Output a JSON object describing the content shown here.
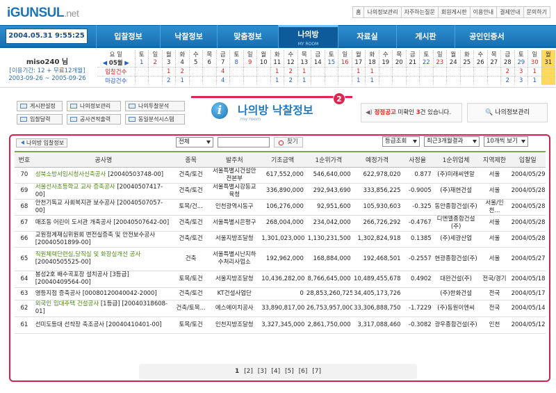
{
  "logo": {
    "main": "iGUNSUL",
    "ext": ".net"
  },
  "topnav": [
    "홈",
    "나의정보관리",
    "자주하는질문",
    "회원게시판",
    "이용안내",
    "결제안내",
    "문의하기"
  ],
  "datetime": "2004.05.31 9:55:25",
  "nav": [
    {
      "label": "입찰정보"
    },
    {
      "label": "낙찰정보"
    },
    {
      "label": "맞춤정보"
    },
    {
      "label": "나의방",
      "sub": "MY ROOM"
    },
    {
      "label": "자료실"
    },
    {
      "label": "게시판"
    },
    {
      "label": "공인인증서"
    }
  ],
  "user": {
    "name": "miso240 님",
    "period": "[이용기간: 12 + 무료12개월]",
    "range": "2003-09-26 ~ 2005-09-26"
  },
  "calendar": {
    "weekday_label": "요 일",
    "month_label": "05월",
    "bid_label": "입찰건수",
    "award_label": "마감건수",
    "weekdays": [
      "토",
      "일",
      "월",
      "화",
      "수",
      "목",
      "금",
      "토",
      "일",
      "월",
      "화",
      "수",
      "목",
      "금",
      "토",
      "일",
      "월",
      "화",
      "수",
      "목",
      "금",
      "토",
      "일",
      "월",
      "화",
      "수",
      "목",
      "금",
      "토",
      "일",
      "월"
    ],
    "days": [
      "1",
      "2",
      "3",
      "4",
      "5",
      "6",
      "7",
      "8",
      "9",
      "10",
      "11",
      "12",
      "13",
      "14",
      "15",
      "16",
      "17",
      "18",
      "19",
      "20",
      "21",
      "22",
      "23",
      "24",
      "25",
      "26",
      "27",
      "28",
      "29",
      "30",
      "31"
    ],
    "bids": [
      "",
      "",
      "1",
      "2",
      "",
      "",
      "4",
      "",
      "",
      "",
      "1",
      "2",
      "1",
      "",
      "",
      "",
      "1",
      "1",
      "",
      "",
      "",
      "",
      "",
      "",
      "",
      "",
      "",
      "2",
      "3",
      "1",
      ""
    ],
    "closes": [
      "",
      "",
      "2",
      "1",
      "",
      "",
      "4",
      "",
      "",
      "",
      "1",
      "2",
      "1",
      "",
      "",
      "",
      "1",
      "1",
      "",
      "",
      "",
      "",
      "",
      "",
      "",
      "",
      "",
      "2",
      "3",
      "1",
      ""
    ]
  },
  "buttons": [
    "게시판설정",
    "나의정보관리",
    "나의투찰분석",
    "입찰달력",
    "공사견적출력",
    "동일분석시스템"
  ],
  "title": {
    "main": "나의방 낙찰정보",
    "sub": "my room",
    "badge": "2"
  },
  "notice": {
    "pre": "정정공고",
    "mid": "미확인",
    "count": "3",
    "post": "건 있습니다."
  },
  "myinfo_label": "나의정보관리",
  "back_label": "나의방 입찰정보",
  "search": {
    "scope": "전체",
    "button": "찾기"
  },
  "filters": [
    "등급조회",
    "최근3개월결과",
    "10개씩 보기"
  ],
  "columns": [
    "번호",
    "공사명",
    "종목",
    "발주처",
    "기초금액",
    "1순위가격",
    "예정가격",
    "사정율",
    "1순위업체",
    "지역제한",
    "입찰일"
  ],
  "rows": [
    {
      "no": "70",
      "name": "성북소방서임시청사신축공사",
      "code": "[20040503748-00]",
      "tag": "",
      "green": true,
      "type": "건축/토건",
      "client": "서울특별시건설안전본부",
      "base": "617,552,000",
      "first": "546,640,000",
      "est": "622,978,020",
      "rate": "0.877",
      "firm": "(주)미래씨엔알",
      "region": "서울",
      "date": "2004/05/29"
    },
    {
      "no": "69",
      "name": "서울선사초등학교 교사 증축공사",
      "code": "[20040507417-00]",
      "tag": "",
      "green": true,
      "type": "건축/토건",
      "client": "서울특별시강동교육청",
      "base": "336,890,000",
      "first": "292,943,690",
      "est": "333,856,225",
      "rate": "-0.9005",
      "firm": "(주)재현건설",
      "region": "서울",
      "date": "2004/05/28"
    },
    {
      "no": "68",
      "name": "안천기독교 사회복지관 보수공사",
      "code": "[20040507057-00]",
      "tag": "",
      "green": false,
      "type": "토목/건...",
      "client": "인천광역시동구",
      "base": "106,276,000",
      "first": "92,951,600",
      "est": "105,930,603",
      "rate": "-0.325",
      "firm": "동안종합건설(주)",
      "region": "서울/인천...",
      "date": "2004/05/28"
    },
    {
      "no": "67",
      "name": "매조동 어린이 도서관 개축공사",
      "code": "[20040507642-00]",
      "tag": "",
      "green": false,
      "type": "건축/토건",
      "client": "서울특별시은평구",
      "base": "268,004,000",
      "first": "234,042,000",
      "est": "266,726,292",
      "rate": "-0.4767",
      "firm": "디엔엘종합건설(주)",
      "region": "서울",
      "date": "2004/05/28"
    },
    {
      "no": "66",
      "name": "교원정계재심위원회 변전실증축 및 안전보수공사",
      "code": "[20040501899-00]",
      "tag": "",
      "green": false,
      "type": "건축/토건",
      "client": "서울지방조달청",
      "base": "1,301,023,000",
      "first": "1,130,231,500",
      "est": "1,302,824,918",
      "rate": "0.1385",
      "firm": "(주)세광산업",
      "region": "서울",
      "date": "2004/05/28"
    },
    {
      "no": "65",
      "name": "직원체력단련실,당직실 및 화장실개선 공사",
      "code": "[20040505525-00]",
      "tag": "",
      "green": true,
      "type": "건축",
      "client": "서울특별시난지하수처리사업소",
      "base": "192,962,000",
      "first": "168,884,000",
      "est": "192,468,501",
      "rate": "-0.2557",
      "firm": "현광종합건설(주)",
      "region": "서울",
      "date": "2004/05/27"
    },
    {
      "no": "64",
      "name": "봉성2호 배수곡포장 설치공사",
      "code": "[20040409564-00]",
      "tag": "[3등급]",
      "green": false,
      "type": "토목/토건",
      "client": "서울지방조달청",
      "base": "10,436,282,000",
      "first": "8,766,645,000",
      "est": "10,489,455,678",
      "rate": "0.4902",
      "firm": "대완건설(주)",
      "region": "전국/경기",
      "date": "2004/05/18"
    },
    {
      "no": "63",
      "name": "영등지점 증축공사",
      "code": "[00080120040042-2000]",
      "tag": "",
      "green": false,
      "type": "건축/토건",
      "client": "KT건설사업단",
      "base": "0",
      "first": "28,853,260,725",
      "est": "34,405,173,726",
      "rate": "",
      "firm": "(주)한화건설",
      "region": "전국",
      "date": "2004/05/17"
    },
    {
      "no": "62",
      "name": "외국인 임대주택 건설공사",
      "code": "[20040318608-01]",
      "tag": "[1등급]",
      "green": true,
      "type": "건축/토목...",
      "client": "에스에이치공사",
      "base": "33,890,817,000",
      "first": "26,753,957,000",
      "est": "33,306,888,750",
      "rate": "-1.7229",
      "firm": "(주)동원이엔씨",
      "region": "전국",
      "date": "2004/05/14"
    },
    {
      "no": "61",
      "name": "선미도등대 선착장 축조공사",
      "code": "[20040410401-00]",
      "tag": "",
      "green": false,
      "type": "토목/토건",
      "client": "인천지방조달청",
      "base": "3,327,345,000",
      "first": "2,861,750,000",
      "est": "3,317,088,460",
      "rate": "-0.3082",
      "firm": "광우종합건설(주)",
      "region": "인천",
      "date": "2004/05/12"
    }
  ],
  "pager": {
    "current": "1",
    "pages": [
      "[2]",
      "[3]",
      "[4]",
      "[5]",
      "[6]",
      "[7]"
    ]
  },
  "colors": {
    "nav": "#2c8fd0",
    "accent": "#d2224a",
    "header_rule": "#7aa843",
    "title": "#2479bb"
  }
}
